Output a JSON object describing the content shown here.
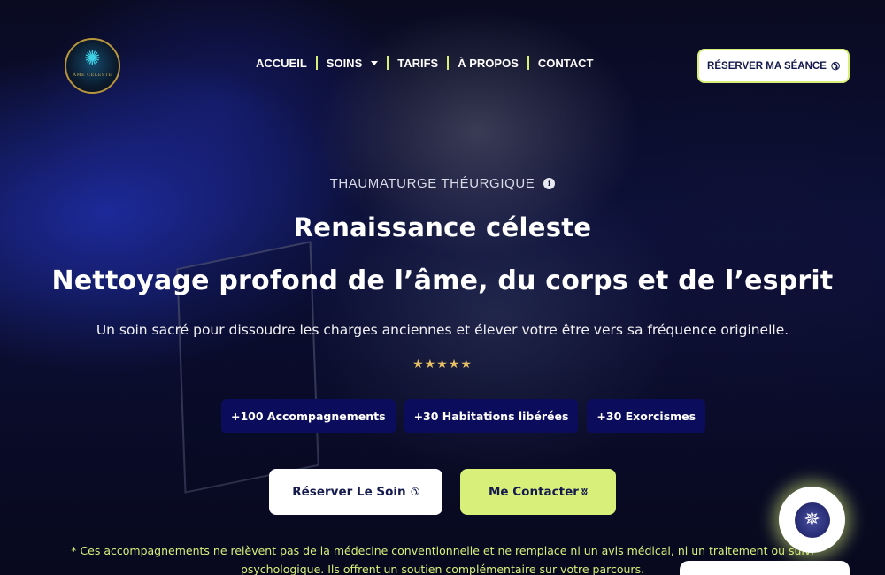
{
  "brand": {
    "logo_text": "ÂME CÉLESTE"
  },
  "nav": {
    "items": [
      {
        "label": "ACCUEIL"
      },
      {
        "label": "SOINS"
      },
      {
        "label": "TARIFS"
      },
      {
        "label": "À PROPOS"
      },
      {
        "label": "CONTACT"
      }
    ],
    "reserve_label": "RÉSERVER MA SÉANCE"
  },
  "hero": {
    "eyebrow": "THAUMATURGE THÉURGIQUE",
    "title_1": "Renaissance céleste",
    "title_2": "Nettoyage profond de l’âme, du corps et de l’esprit",
    "subtitle": "Un soin sacré pour dissoudre les charges anciennes et élever votre être vers sa fréquence originelle.",
    "rating": 5,
    "stats": [
      {
        "label": "+100 Accompagnements"
      },
      {
        "label": "+30 Habitations libérées"
      },
      {
        "label": "+30 Exorcismes"
      }
    ],
    "cta_reserve": "Réserver Le Soin",
    "cta_contact": "Me Contacter",
    "disclaimer": "* Ces accompagnements ne relèvent pas de la médecine conventionnelle et ne remplace ni un avis médical, ni un traitement ou suivi psychologique. Ils offrent un soutien complémentaire sur votre parcours."
  },
  "colors": {
    "accent": "#d8ef7a",
    "navy": "#141a4e",
    "stat_bg": "#0c0c5c",
    "star": "#e8c165"
  },
  "icons": {
    "phone": "phone-icon",
    "info": "info-icon",
    "hands": "praying-hands-icon",
    "chat": "compass-star-icon"
  }
}
